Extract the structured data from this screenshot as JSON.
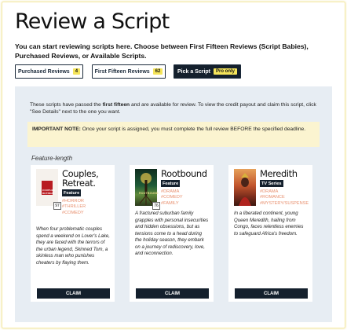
{
  "page": {
    "title": "Review a Script",
    "intro": "You can start reviewing scripts here. Choose between First Fifteen Reviews (Script Babies), Purchased Reviews, or Available Scripts."
  },
  "tabs": [
    {
      "label": "Purchased Reviews",
      "badge": "4"
    },
    {
      "label": "First Fifteen Reviews",
      "badge": "62"
    },
    {
      "label": "Pick a Script",
      "badge": "Pro only"
    }
  ],
  "panel": {
    "text_before": "These scripts have passed the ",
    "text_bold": "first fifteen",
    "text_after": " and are available for review. To view the credit payout and claim this script, click \"See Details\" next to the one you want.",
    "note_bold": "IMPORTANT NOTE:",
    "note_text": " Once your script is assigned, you must complete the full review BEFORE the specified deadline.",
    "section_label": "Feature-length"
  },
  "cards": [
    {
      "title": "Couples, Retreat.",
      "type": "Feature",
      "tags": [
        "#HORROR",
        "#THRILLER",
        "#COMEDY"
      ],
      "pages": "97",
      "cover_label": "COUPLES RETREAT",
      "description": "When four problematic couples spend a weekend on Lover's Lake, they are faced with the terrors of the urban legend, Skinned Tom, a skinless man who punishes cheaters by flaying them.",
      "claim": "CLAIM"
    },
    {
      "title": "Rootbound",
      "type": "Feature",
      "tags": [
        "#DRAMA",
        "#COMEDY",
        "#FAMILY"
      ],
      "pages": "76",
      "cover_label": "ROOTBOUND",
      "description": "A fractured suburban family grapples with personal insecurities and hidden obsessions, but as tensions come to a head during the holiday season, they embark on a journey of rediscovery, love, and reconnection.",
      "claim": "CLAIM"
    },
    {
      "title": "Meredith",
      "type": "TV Series",
      "tags": [
        "#DRAMA",
        "#ROMANCE",
        "#MYSTERY/SUSPENSE"
      ],
      "pages": "",
      "cover_label": "",
      "description": "In a liberated continent, young Queen Meredith, hailing from Congo, faces relentless enemies to safeguard Africa's freedom.",
      "claim": "CLAIM"
    }
  ],
  "colors": {
    "navy": "#14202d",
    "panel_bg": "#e7edf3",
    "note_bg": "#fbf4d0",
    "badge_yellow": "#f5e55b",
    "tag_orange": "#e8906f"
  }
}
